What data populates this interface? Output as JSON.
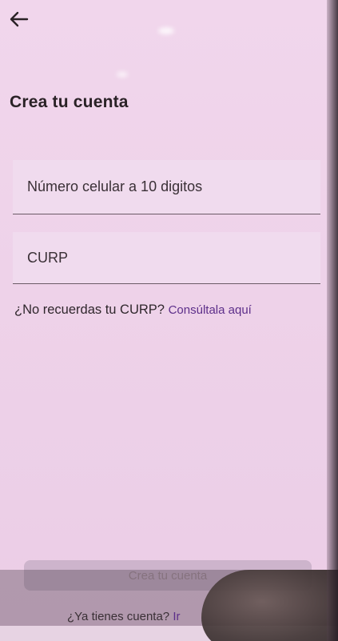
{
  "header": {
    "back_icon": "arrow-left-icon"
  },
  "page": {
    "title": "Crea tu cuenta"
  },
  "form": {
    "phone_placeholder": "Número celular a 10 digitos",
    "curp_placeholder": "CURP"
  },
  "help": {
    "question": "¿No recuerdas tu CURP?",
    "link": "Consúltala aquí"
  },
  "footer": {
    "cta_label": "Crea tu cuenta",
    "login_question": "¿Ya tienes cuenta?",
    "login_link": "Ir"
  },
  "colors": {
    "background": "#eed2e9",
    "accent_link": "#5d2f8a",
    "button_disabled": "#cdb4cc"
  }
}
